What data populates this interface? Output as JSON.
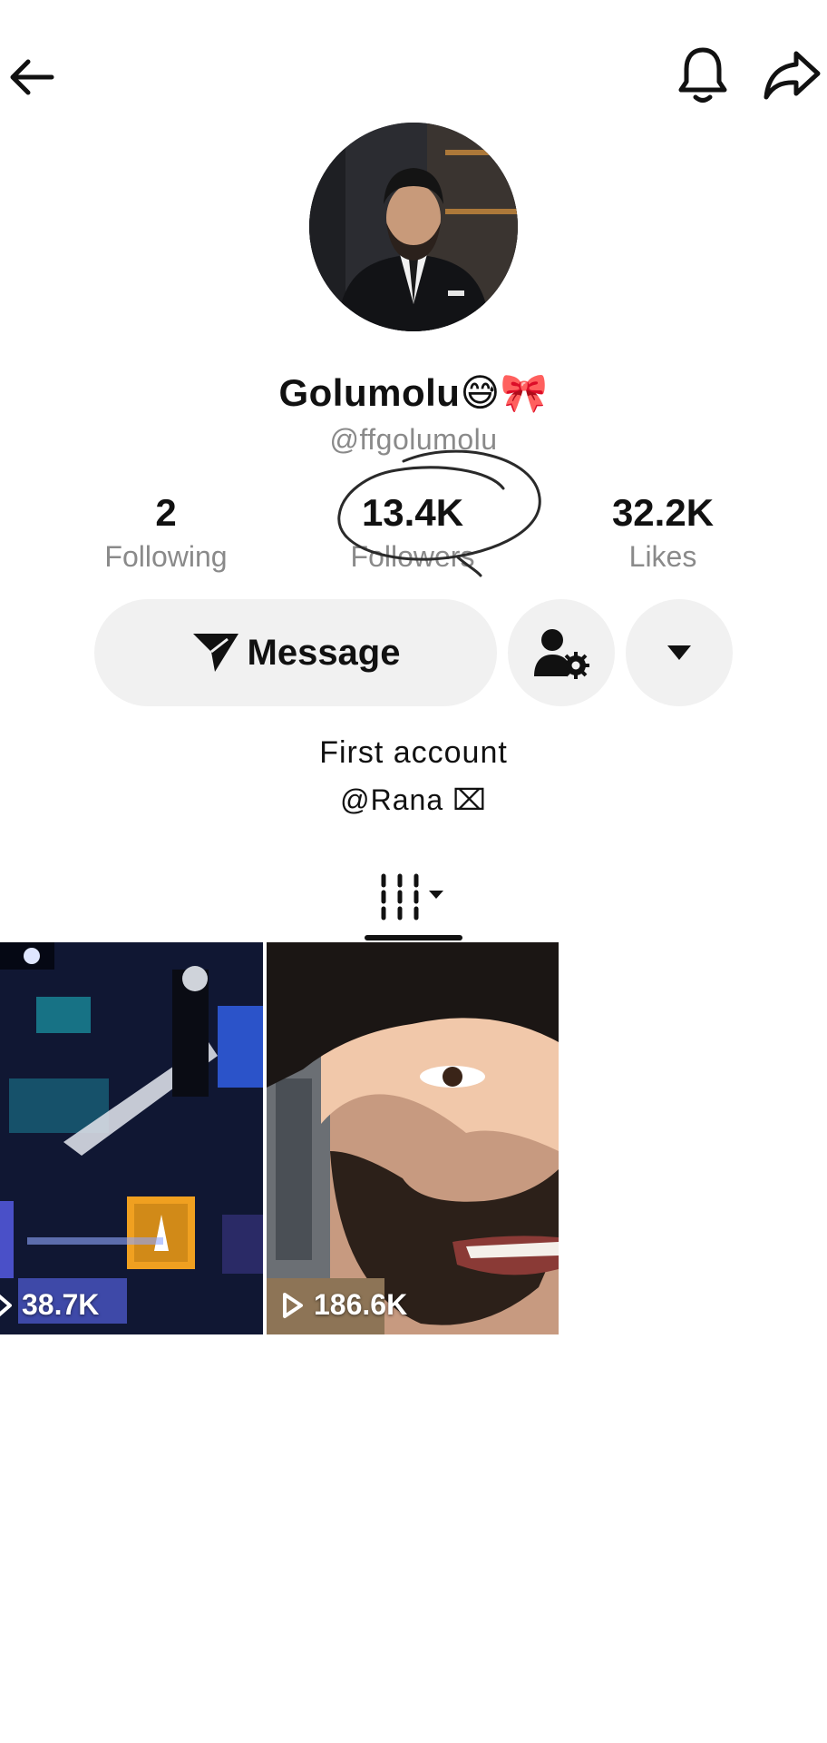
{
  "header": {
    "back_icon": "arrow-left-icon",
    "bell_icon": "bell-icon",
    "share_icon": "share-arrow-icon"
  },
  "profile": {
    "display_name": "Golumolu",
    "name_emojis": "😅🎀",
    "username": "@ffgolumolu"
  },
  "stats": [
    {
      "value": "2",
      "label": "Following"
    },
    {
      "value": "13.4K",
      "label": "Followers"
    },
    {
      "value": "32.2K",
      "label": "Likes"
    }
  ],
  "actions": {
    "message_label": "Message",
    "follow_settings_icon": "person-gear-icon",
    "more_icon": "caret-down-icon"
  },
  "bio": {
    "line1": "First account",
    "line2": "@Rana ⌧"
  },
  "tabs": {
    "videos_icon": "grid-bars-icon"
  },
  "videos": [
    {
      "views": "38.7K"
    },
    {
      "views": "186.6K"
    }
  ],
  "colors": {
    "text": "#111111",
    "secondary_text": "#8a8a8a",
    "button_bg": "#f1f1f1"
  }
}
